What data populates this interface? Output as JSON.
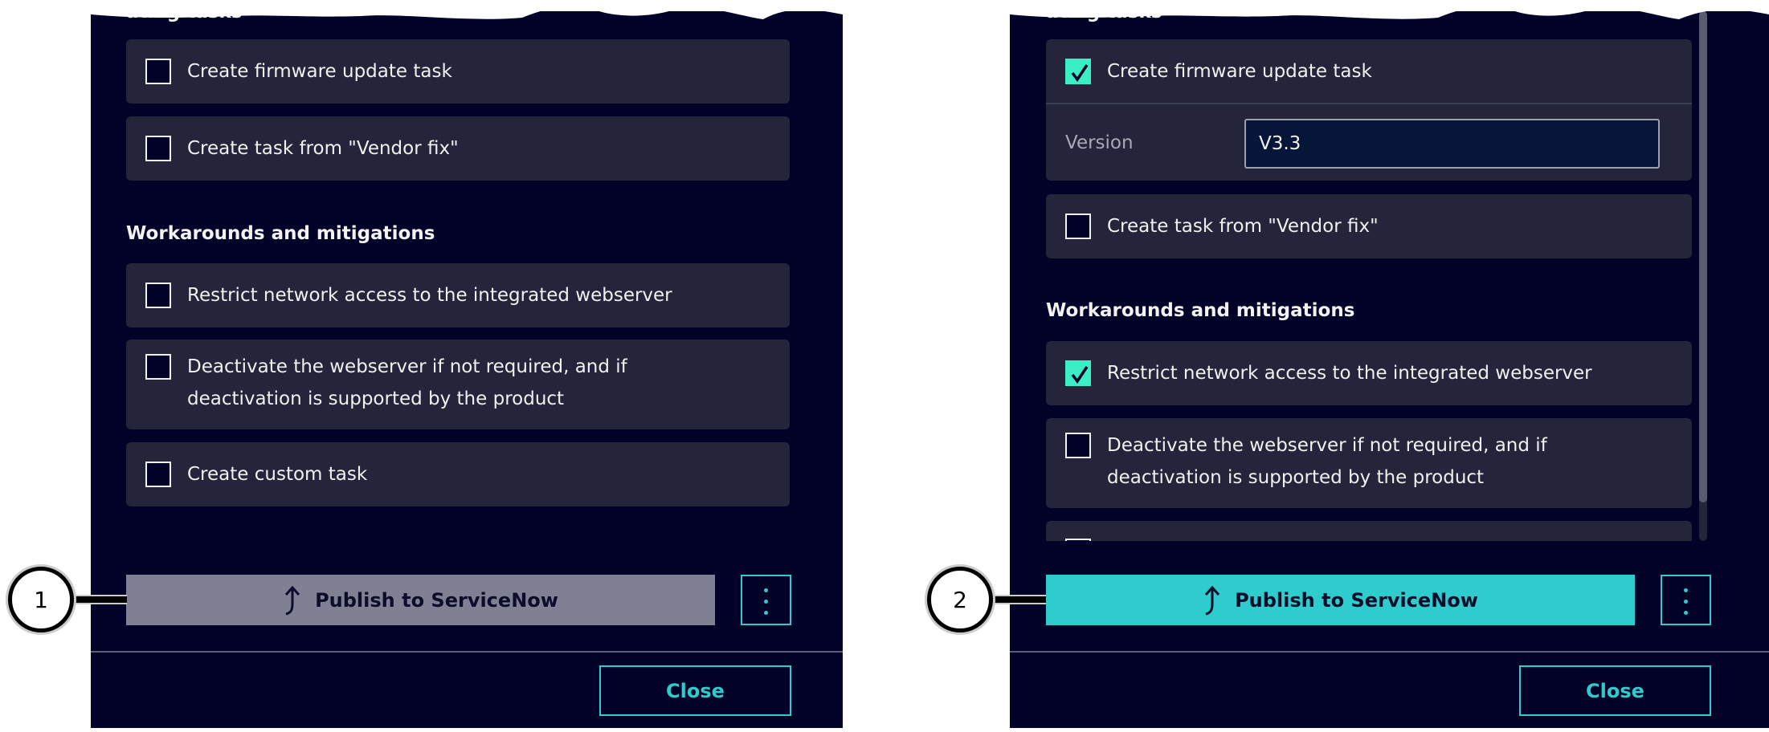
{
  "colors": {
    "panel_bg": "#020228",
    "card_bg": "#24243a",
    "accent": "#2ecccc",
    "check": "#3ceec4",
    "disabled_button": "#7f8093"
  },
  "left": {
    "callout": "1",
    "section_partial": "ating tasks",
    "items": [
      {
        "label": "Create firmware update task",
        "checked": false
      },
      {
        "label": "Create task from \"Vendor fix\"",
        "checked": false
      }
    ],
    "workarounds_heading": "Workarounds and mitigations",
    "workarounds": [
      {
        "label": "Restrict network access to the integrated webserver",
        "checked": false
      },
      {
        "label": "Deactivate the webserver if not required, and if deactivation is supported by the product",
        "checked": false
      },
      {
        "label": "Create custom task",
        "checked": false
      }
    ],
    "publish_label": "Publish to ServiceNow",
    "publish_state": "disabled",
    "close_label": "Close"
  },
  "right": {
    "callout": "2",
    "section_partial": "ating tasks",
    "items": [
      {
        "label": "Create firmware update task",
        "checked": true
      },
      {
        "label": "Create task from \"Vendor fix\"",
        "checked": false
      }
    ],
    "version_label": "Version",
    "version_value": "V3.3",
    "workarounds_heading": "Workarounds and mitigations",
    "workarounds": [
      {
        "label": "Restrict network access to the integrated webserver",
        "checked": true
      },
      {
        "label": "Deactivate the webserver if not required, and if deactivation is supported by the product",
        "checked": false
      }
    ],
    "publish_label": "Publish to ServiceNow",
    "publish_state": "enabled",
    "close_label": "Close"
  }
}
